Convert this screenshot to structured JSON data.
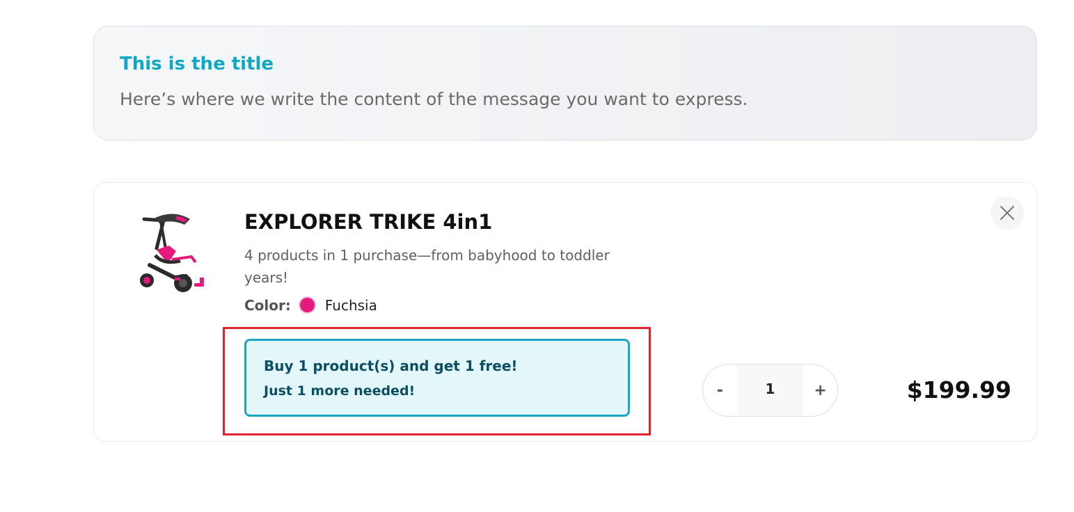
{
  "message": {
    "title": "This is the title",
    "content": "Here’s where we write the content of the message you want to express."
  },
  "cart_item": {
    "title": "EXPLORER TRIKE 4in1",
    "description": "4 products in 1 purchase—from babyhood to toddler years!",
    "color_label": "Color:",
    "color_value": "Fuchsia",
    "color_hex": "#e41b7c",
    "promo": {
      "line1": "Buy 1 product(s) and get 1 free!",
      "line2": "Just 1 more needed!"
    },
    "quantity": {
      "decrement_label": "-",
      "value": "1",
      "increment_label": "+"
    },
    "price": "$199.99",
    "remove_icon": "close-icon",
    "image_icon": "trike-product-image"
  },
  "colors": {
    "accent": "#0fa8c4",
    "promo_border": "#1aa7c0",
    "promo_bg": "#e3f6f9",
    "highlight": "#e0222e"
  }
}
